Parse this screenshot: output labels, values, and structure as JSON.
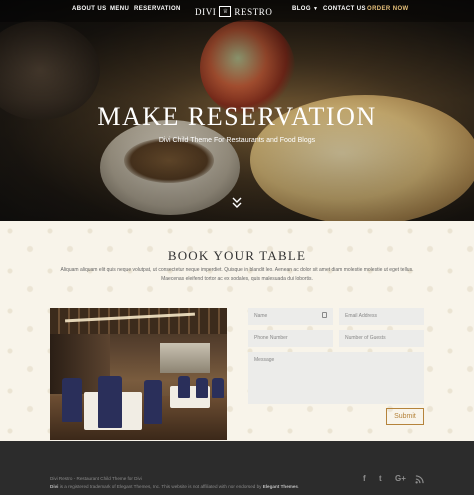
{
  "nav": {
    "left": [
      "ABOUT US",
      "MENU",
      "RESERVATION"
    ],
    "right": [
      "BLOG",
      "CONTACT US",
      "ORDER NOW"
    ],
    "logo_word1": "DIVI",
    "logo_word2": "RESTRO",
    "order_color": "#e6c07a"
  },
  "hero": {
    "title": "MAKE RESERVATION",
    "subtitle": "Divi Child Theme For Restaurants and Food Blogs",
    "scroll_icon": "double-chevron-down-icon"
  },
  "booking": {
    "title": "BOOK YOUR TABLE",
    "text": "Aliquam aliquam elit quis neque volutpat, ut consectetur neque imperdiet. Quisque in blandit leo. Aenean ac dolor sit amet diam molestie molestie ut eget tellus. Maecenas eleifend tortor ac ex sodales, quis malesuada dui lobortis."
  },
  "form": {
    "name_placeholder": "Name",
    "email_placeholder": "Email Address",
    "phone_placeholder": "Phone Number",
    "guests_placeholder": "Number of Guests",
    "message_placeholder": "Message",
    "submit_label": "Submit",
    "accent": "#b5833b"
  },
  "footer": {
    "line1": "Divi Restro - Restaurant Child Theme for Divi",
    "line2_brand": "Divi",
    "line2_text": " is a registered trademark of Elegant Themes, Inc. This website is not affiliated with nor endorsed by ",
    "line2_company": "Elegant Themes",
    "line2_end": ".",
    "social": [
      "f",
      "t",
      "G+",
      "rss"
    ]
  }
}
